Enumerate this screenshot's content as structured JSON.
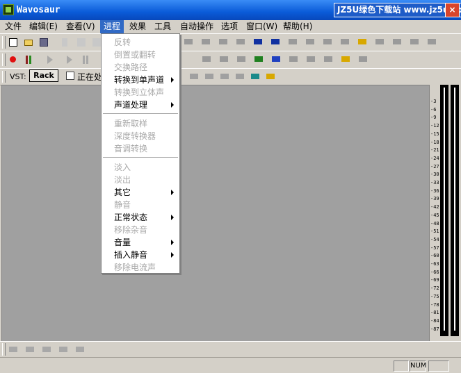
{
  "window": {
    "title": "Wavosaur",
    "banner": "JZ5U绿色下载站 www.jz5u.com",
    "close": "×"
  },
  "menubar": [
    {
      "label": "文件",
      "active": false
    },
    {
      "label": "编辑(E)",
      "active": false
    },
    {
      "label": "查看(V)",
      "active": false
    },
    {
      "label": "进程",
      "active": true
    },
    {
      "label": "效果",
      "active": false
    },
    {
      "label": "工具",
      "active": false
    },
    {
      "label": "自动操作",
      "active": false
    },
    {
      "label": "选项",
      "active": false
    },
    {
      "label": "窗口(W)",
      "active": false
    },
    {
      "label": "帮助(H)",
      "active": false
    }
  ],
  "process_menu": [
    {
      "label": "反转",
      "enabled": false,
      "submenu": false
    },
    {
      "label": "倒置或翻转",
      "enabled": false,
      "submenu": false
    },
    {
      "label": "交换路径",
      "enabled": false,
      "submenu": false
    },
    {
      "label": "转换到单声道",
      "enabled": true,
      "submenu": true
    },
    {
      "label": "转换到立体声",
      "enabled": false,
      "submenu": false
    },
    {
      "label": "声道处理",
      "enabled": true,
      "submenu": true
    },
    {
      "separator": true
    },
    {
      "label": "重新取样",
      "enabled": false,
      "submenu": false
    },
    {
      "label": "深度转换器",
      "enabled": false,
      "submenu": false
    },
    {
      "label": "音调转换",
      "enabled": false,
      "submenu": false
    },
    {
      "separator": true
    },
    {
      "label": "淡入",
      "enabled": false,
      "submenu": false
    },
    {
      "label": "淡出",
      "enabled": false,
      "submenu": false
    },
    {
      "label": "其它",
      "enabled": true,
      "submenu": true
    },
    {
      "label": "静音",
      "enabled": false,
      "submenu": false
    },
    {
      "label": "正常状态",
      "enabled": true,
      "submenu": true
    },
    {
      "label": "移除杂音",
      "enabled": false,
      "submenu": false
    },
    {
      "label": "音量",
      "enabled": true,
      "submenu": true
    },
    {
      "label": "插入静音",
      "enabled": true,
      "submenu": true
    },
    {
      "label": "移除电流声",
      "enabled": false,
      "submenu": false
    }
  ],
  "vst_bar": {
    "label": "VST:",
    "rack_button": "Rack",
    "checkbox_label": "正在处"
  },
  "meter_ticks": [
    "-3",
    "-6",
    "-9",
    "-12",
    "-15",
    "-18",
    "-21",
    "-24",
    "-27",
    "-30",
    "-33",
    "-36",
    "-39",
    "-42",
    "-45",
    "-48",
    "-51",
    "-54",
    "-57",
    "-60",
    "-63",
    "-66",
    "-69",
    "-72",
    "-75",
    "-78",
    "-81",
    "-84",
    "-87"
  ],
  "status": {
    "num": "NUM"
  },
  "colors": {
    "title_blue": "#0a5bd8",
    "menu_highlight": "#316ac5",
    "workspace": "#a0a0a0",
    "record_red": "#e01010"
  },
  "toolbar1_icons": [
    "new-file-icon",
    "open-folder-icon",
    "save-icon",
    "cut-icon",
    "copy-icon",
    "paste-icon"
  ],
  "toolbar1_right_icons": [
    "speaker-icon",
    "loop-icon",
    "link-icon",
    "chain-icon",
    "waveform-icon",
    "waveform-stereo-icon",
    "marker-icon",
    "trim-left-icon",
    "trim-right-icon",
    "spread-icon",
    "lock-icon",
    "trash-icon",
    "slice-icon",
    "join-icon",
    "nudge-icon"
  ],
  "toolbar2_icons": [
    "record-icon",
    "pause-icon",
    "play-start-icon",
    "play-icon",
    "stop-icon"
  ],
  "toolbar2_right_icons": [
    "markers-icon",
    "envelope-icon",
    "split-icon",
    "eq-icon",
    "pencil-icon",
    "move-left-icon",
    "move-right-icon",
    "region-icon",
    "lock-icon",
    "trash-icon"
  ],
  "toolbar3_icons": [
    "check-icon",
    "dots-icon",
    "split-vertical-icon",
    "close-x-icon",
    "play-selection-icon",
    "lock-icon"
  ],
  "bottom_icons": [
    "zoom-in-icon",
    "zoom-out-icon",
    "zoom-fit-icon",
    "zoom-in-vertical-icon",
    "zoom-out-vertical-icon"
  ]
}
